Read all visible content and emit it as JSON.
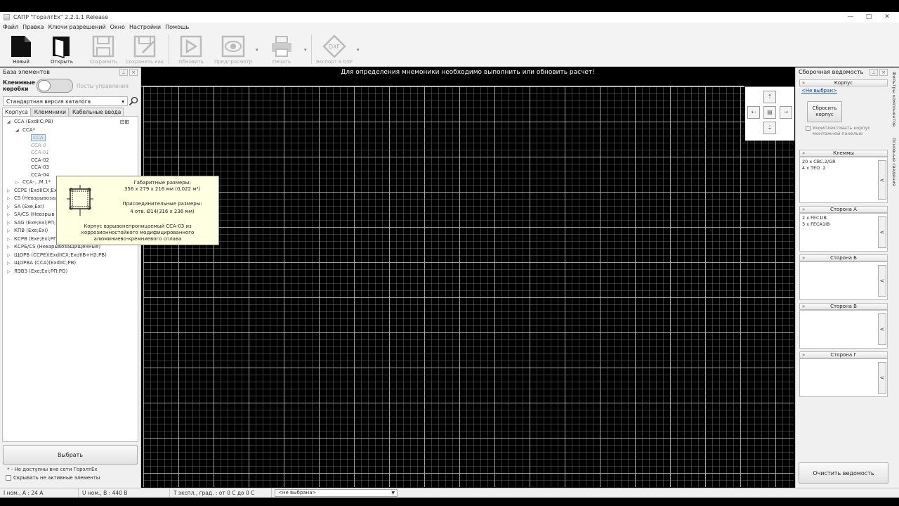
{
  "window": {
    "title": "САПР \"ГорэлтЕх\" 2.2.1.1 Release",
    "controls": [
      "—",
      "□",
      "✕"
    ]
  },
  "menu": [
    "Файл",
    "Правка",
    "Ключи разрешений",
    "Окно",
    "Настройки",
    "Помощь"
  ],
  "toolbar": {
    "new": "Новый",
    "open": "Открыть",
    "save": "Сохранить",
    "save_as": "Сохранить как",
    "refresh": "Обновить",
    "preview": "Предпросмотр",
    "print": "Печать",
    "export_dxf": "Экспорт в DXF",
    "dxf_badge": "DXF"
  },
  "left_panel": {
    "title": "База элементов",
    "toggle_left": "Клеммные коробки",
    "toggle_right": "Посты управления",
    "catalog": "Стандартная версия каталога",
    "tabs": [
      "Корпуса",
      "Клеммники",
      "Кабельные ввода"
    ],
    "tree": [
      {
        "exp": "◢",
        "indent": 0,
        "text": "ССА (ExdIIC;PB)",
        "style": ""
      },
      {
        "exp": "◢",
        "indent": 1,
        "text": "ССА*",
        "style": ""
      },
      {
        "exp": "",
        "indent": 2,
        "text": "ССА",
        "style": "sel"
      },
      {
        "exp": "",
        "indent": 2,
        "text": "ССА-0",
        "style": "dim"
      },
      {
        "exp": "",
        "indent": 2,
        "text": "ССА-01",
        "style": "dim"
      },
      {
        "exp": "",
        "indent": 2,
        "text": "ССА-02",
        "style": ""
      },
      {
        "exp": "",
        "indent": 2,
        "text": "ССА-03",
        "style": ""
      },
      {
        "exp": "",
        "indent": 2,
        "text": "ССА-04",
        "style": ""
      },
      {
        "exp": "▷",
        "indent": 1,
        "text": "ССА-...М.1*",
        "style": ""
      },
      {
        "exp": "▷",
        "indent": 0,
        "text": "ССРЕ (ExdIICX;Ex",
        "style": ""
      },
      {
        "exp": "▷",
        "indent": 0,
        "text": "CS (Невзрывозащ",
        "style": ""
      },
      {
        "exp": "▷",
        "indent": 0,
        "text": "SA (Exe;Exi)",
        "style": ""
      },
      {
        "exp": "▷",
        "indent": 0,
        "text": "SA/CS (Невзрыв",
        "style": ""
      },
      {
        "exp": "▷",
        "indent": 0,
        "text": "SAG (Exe;Exi;PП;I",
        "style": ""
      },
      {
        "exp": "▷",
        "indent": 0,
        "text": "КПВ (Exe;Exi)",
        "style": ""
      },
      {
        "exp": "▷",
        "indent": 0,
        "text": "КСРВ (Exe;Exi;PП",
        "style": ""
      },
      {
        "exp": "▷",
        "indent": 0,
        "text": "КСРБ/CS (Невзрывозащищенные)",
        "style": ""
      },
      {
        "exp": "▷",
        "indent": 0,
        "text": "ЩОРВ (ССРЕ)(ExdIICX;ExdIIB+H2;PB)",
        "style": ""
      },
      {
        "exp": "▷",
        "indent": 0,
        "text": "ЩОРВА (ССА)(ExdIIC;PB)",
        "style": ""
      },
      {
        "exp": "▷",
        "indent": 0,
        "text": "ЯЭВЗ (Exe;Exi;PП;PO)",
        "style": ""
      }
    ],
    "select_button": "Выбрать",
    "note": "* - Не доступны вне сети ГорэлтЕх",
    "hide_inactive": "Скрывать не активные элементы"
  },
  "tooltip": {
    "dims_title": "Габаритные размеры:",
    "dims_value": "356 x 279 x 216 мм (0,022 м³)",
    "conn_title": "Присоединительные размеры:",
    "conn_value": "4 отв. Ø14(316 x 236 мм)",
    "description": "Корпус взрывонепроницаемый ССА-03 из коррозионностойкого модифицированного алюминиево-кремниевого сплава"
  },
  "center": {
    "message": "Для определения мнемоники необходимо выполнить или обновить расчет!"
  },
  "right_panel": {
    "title": "Сборочная ведомость",
    "housing_header": "Корпус",
    "housing_link": "<Не выбран>",
    "reset_button": "Сбросить корпус",
    "complete_checkbox": "Укомплектовать корпус монтажной панелью",
    "terminals_header": "Клеммы",
    "terminals": [
      "20 x CBC.2/GR",
      "4 x TEO .2"
    ],
    "side_a_header": "Сторона А",
    "side_a": [
      "2 x FEC1IB",
      "3 x FECA1IB"
    ],
    "side_b_header": "Сторона Б",
    "side_c_header": "Сторона В",
    "side_d_header": "Сторона Г",
    "clear_button": "Очистить ведомость",
    "vertical_tabs": [
      "Основные сведения",
      "Фильтры компонентов"
    ]
  },
  "status": {
    "current": "I ном., А : 24 А",
    "voltage": "U ном., В : 440 В",
    "temp": "Т экспл., град. : от 0 С до 0 С",
    "combo": "<не выбрана>"
  }
}
